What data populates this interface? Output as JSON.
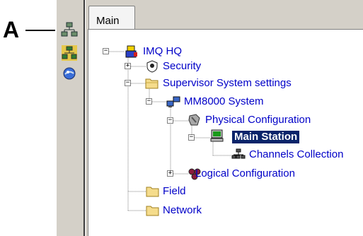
{
  "callout": {
    "letter": "A"
  },
  "toolbar": {
    "buttons": [
      {
        "name": "network-icon"
      },
      {
        "name": "hierarchy-icon"
      },
      {
        "name": "globe-icon"
      }
    ]
  },
  "tabs": [
    {
      "label": "Main"
    }
  ],
  "tree": {
    "root": {
      "label": "IMQ HQ",
      "expander": "−"
    },
    "security": {
      "label": "Security",
      "expander": "+"
    },
    "supervisor": {
      "label": "Supervisor System settings",
      "expander": "−"
    },
    "mm8000": {
      "label": "MM8000 System",
      "expander": "−"
    },
    "physical": {
      "label": "Physical Configuration",
      "expander": "−"
    },
    "main_station": {
      "label": "Main Station",
      "expander": "−"
    },
    "channels": {
      "label": "Channels Collection"
    },
    "logical": {
      "label": "Logical Configuration",
      "expander": "+"
    },
    "field": {
      "label": "Field"
    },
    "network": {
      "label": "Network"
    }
  },
  "colors": {
    "link": "#0000c8",
    "selection": "#0a246a",
    "panel": "#d4d0c8",
    "folder": "#f5dc8c"
  }
}
